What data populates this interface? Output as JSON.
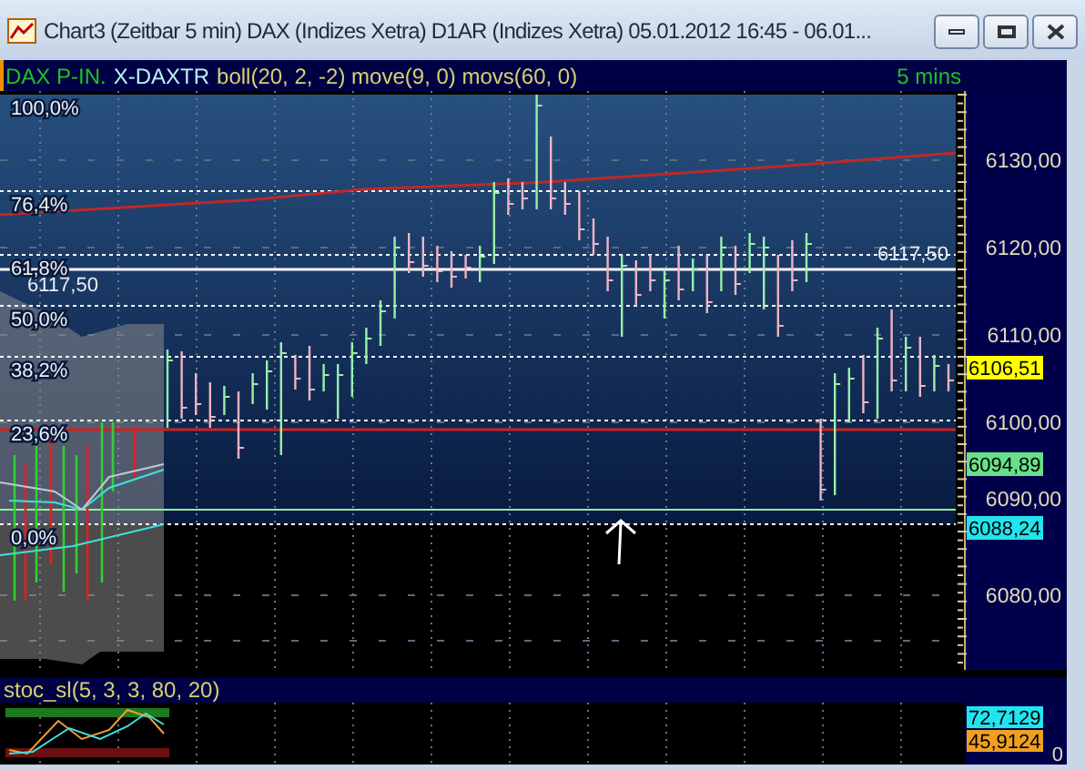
{
  "window": {
    "title": "Chart3 (Zeitbar 5 min)  DAX (Indizes Xetra) D1AR (Indizes Xetra) 05.01.2012 16:45 - 06.01..."
  },
  "chart_header": {
    "symbol": "DAX P-IN.",
    "instrument": "X-DAXTR",
    "indicators": "boll(20, 2, -2) move(9, 0) movs(60, 0)",
    "interval": "5 mins"
  },
  "price_chart": {
    "fib_levels": [
      {
        "label": "100,0%"
      },
      {
        "label": "76,4%"
      },
      {
        "label": "61,8%"
      },
      {
        "label": "50,0%"
      },
      {
        "label": "38,2%"
      },
      {
        "label": "23,6%"
      },
      {
        "label": "0,0%"
      }
    ],
    "line_labels": [
      {
        "text": "6117,50"
      },
      {
        "text": "6117,50"
      }
    ],
    "price_axis": [
      "6130,00",
      "6120,00",
      "6110,00",
      "6100,00",
      "6090,00",
      "6080,00"
    ],
    "price_tags": [
      {
        "text": "6106,51",
        "color": "#ffff00"
      },
      {
        "text": "6094,89",
        "color": "#66e08a"
      },
      {
        "text": "6088,24",
        "color": "#22e4ee"
      }
    ]
  },
  "stochastic": {
    "title": "stoc_sl(5, 3, 3, 80, 20)",
    "value_tags": [
      {
        "text": "72,7129",
        "color": "#22e4ee"
      },
      {
        "text": "45,9124",
        "color": "#f0a020"
      }
    ],
    "axis": [
      "0"
    ]
  }
}
